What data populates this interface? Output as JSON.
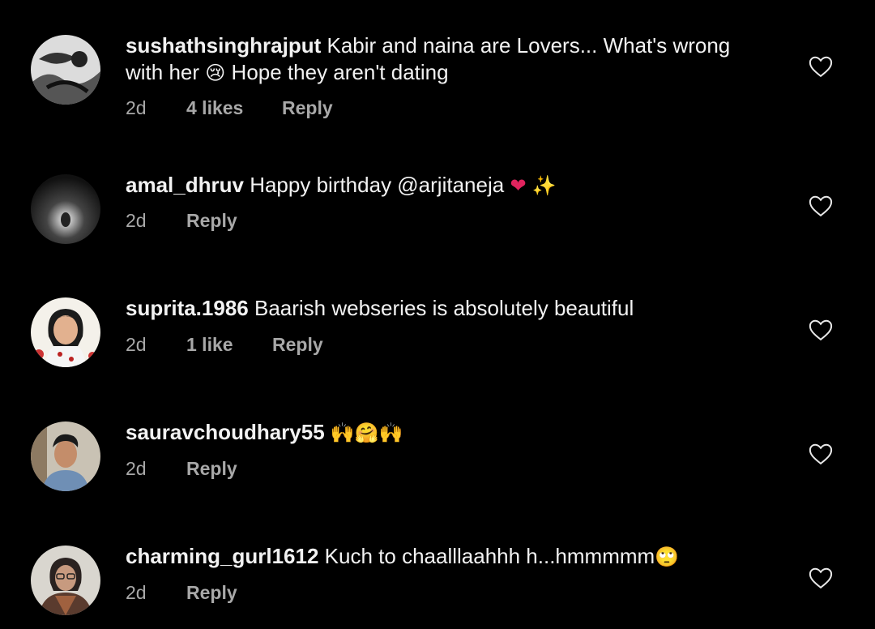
{
  "comments": [
    {
      "username": "sushathsinghrajput",
      "text_a": "Kabir and naina are Lovers... What's wrong with her",
      "emoji_a": "😢",
      "text_b": "Hope they aren't dating",
      "time": "2d",
      "likes": "4 likes",
      "reply": "Reply",
      "avatar_icon": "bw-photo-avatar",
      "like_icon": "heart-outline-icon"
    },
    {
      "username": "amal_dhruv",
      "text_a": "Happy birthday @arjitaneja",
      "emoji_a": "❤",
      "emoji_b": "✨",
      "time": "2d",
      "reply": "Reply",
      "avatar_icon": "tunnel-photo-avatar",
      "like_icon": "heart-outline-icon"
    },
    {
      "username": "suprita.1986",
      "text_a": "Baarish webseries is absolutely beautiful",
      "time": "2d",
      "likes": "1 like",
      "reply": "Reply",
      "avatar_icon": "woman-portrait-avatar",
      "like_icon": "heart-outline-icon"
    },
    {
      "username": "sauravchoudhary55",
      "emoji_a": "🙌🤗🙌",
      "time": "2d",
      "reply": "Reply",
      "avatar_icon": "man-portrait-avatar",
      "like_icon": "heart-outline-icon"
    },
    {
      "username": "charming_gurl1612",
      "text_a": "Kuch to chaalllaahhh h...hmmmmm",
      "emoji_a": "🙄",
      "time": "2d",
      "reply": "Reply",
      "avatar_icon": "woman-glasses-avatar",
      "like_icon": "heart-outline-icon"
    }
  ],
  "colors": {
    "background": "#000000",
    "primary_text": "#f2f2f2",
    "secondary_text": "#a8a8a8",
    "heart_red": "#e0245e"
  }
}
